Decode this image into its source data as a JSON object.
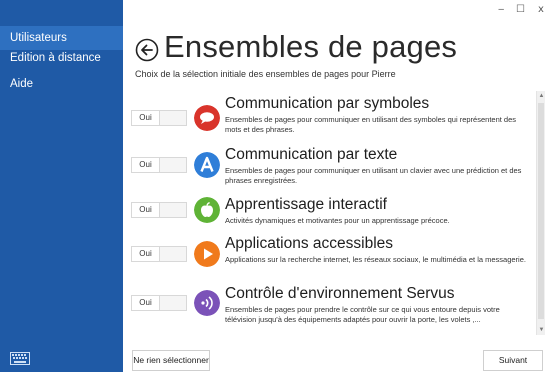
{
  "sidebar": {
    "items": [
      {
        "label": "Utilisateurs"
      },
      {
        "label": "Edition à distance"
      },
      {
        "label": "Aide"
      }
    ]
  },
  "window": {
    "minimize": "‒",
    "maximize": "☐",
    "close": "x"
  },
  "header": {
    "title": "Ensembles de pages",
    "subtitle": "Choix de la sélection initiale des ensembles de pages pour Pierre"
  },
  "pagesets": [
    {
      "toggle": "Oui",
      "icon": "speech-bubble-icon",
      "color": "#d9342b",
      "title": "Communication par symboles",
      "description": "Ensembles de pages pour communiquer en utilisant des symboles qui représentent des mots et des phrases."
    },
    {
      "toggle": "Oui",
      "icon": "letter-a-icon",
      "color": "#2f7ed8",
      "title": "Communication par texte",
      "description": "Ensembles de pages pour communiquer en utilisant un clavier avec une prédiction et des phrases enregistrées."
    },
    {
      "toggle": "Oui",
      "icon": "apple-icon",
      "color": "#5fb336",
      "title": "Apprentissage interactif",
      "description": "Activités dynamiques et motivantes pour un apprentissage précoce."
    },
    {
      "toggle": "Oui",
      "icon": "play-icon",
      "color": "#f07a1c",
      "title": "Applications accessibles",
      "description": "Applications sur la recherche internet, les réseaux sociaux, le multimédia et la messagerie."
    },
    {
      "toggle": "Oui",
      "icon": "wireless-signal-icon",
      "color": "#7b52b8",
      "title": "Contrôle d'environnement Servus",
      "description": "Ensembles de  pages pour prendre le contrôle sur ce qui vous entoure depuis votre télévision jusqu'à des équipements adaptés pour ouvrir la porte, les volets ,..."
    }
  ],
  "footer": {
    "select_none": "Ne rien sélectionner",
    "next": "Suivant"
  }
}
